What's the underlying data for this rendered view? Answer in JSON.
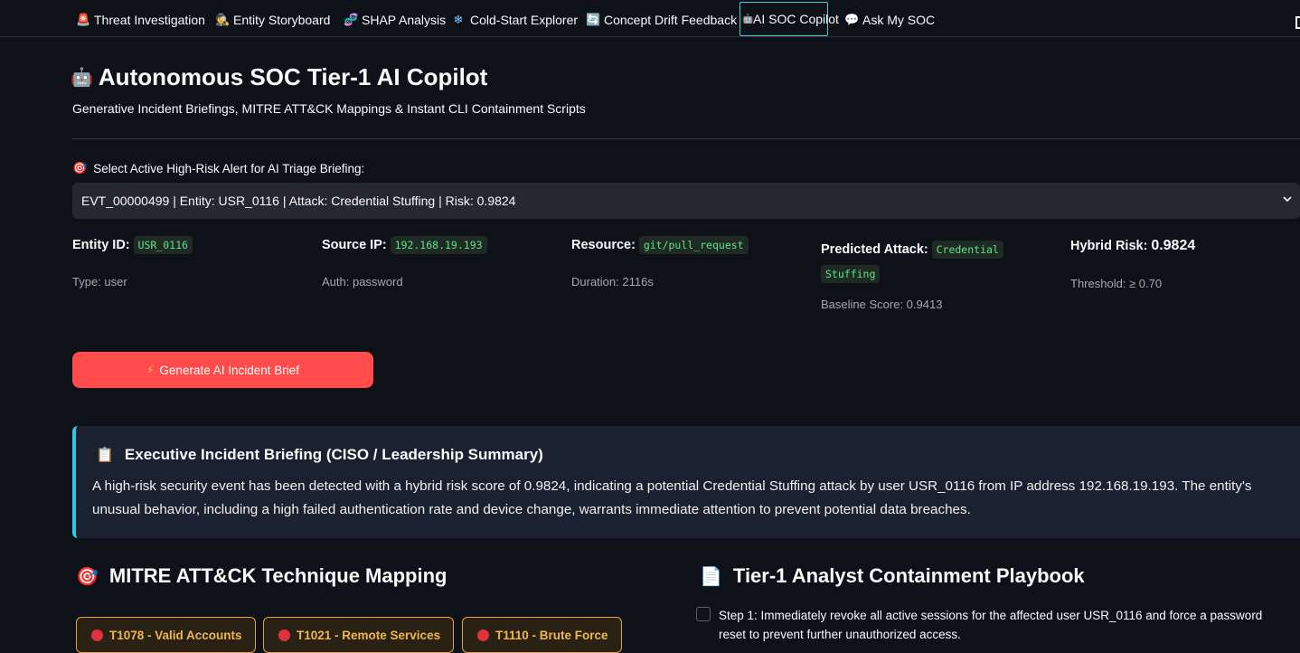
{
  "tabs": [
    {
      "label": "Threat Investigation",
      "icon": "🚨"
    },
    {
      "label": "Entity Storyboard",
      "icon": "🕵"
    },
    {
      "label": "SHAP Analysis",
      "icon": "🧬"
    },
    {
      "label": "Cold-Start Explorer",
      "icon": "❄"
    },
    {
      "label": "Concept Drift Feedback",
      "icon": "🔄"
    },
    {
      "label": "AI SOC Copilot",
      "icon": "🤖"
    },
    {
      "label": "Ask My SOC",
      "icon": "💬"
    }
  ],
  "active_tab": "AI SOC Copilot",
  "page": {
    "title_icon": "🤖",
    "title": "Autonomous SOC Tier-1 AI Copilot",
    "subtitle": "Generative Incident Briefings, MITRE ATT&CK Mappings & Instant CLI Containment Scripts"
  },
  "alert_select": {
    "icon": "🎯",
    "label": "Select Active High-Risk Alert for AI Triage Briefing:",
    "selected": "EVT_00000499 | Entity: USR_0116 | Attack: Credential Stuffing | Risk: 0.9824"
  },
  "metrics": {
    "entity": {
      "label": "Entity ID:",
      "value": "USR_0116",
      "meta": "Type: user"
    },
    "source_ip": {
      "label": "Source IP:",
      "value": "192.168.19.193",
      "meta": "Auth: password"
    },
    "resource": {
      "label": "Resource:",
      "value": "git/pull_request",
      "meta": "Duration: 2116s"
    },
    "predicted": {
      "label": "Predicted Attack:",
      "value_line1": "Credential",
      "value_line2": "Stuffing",
      "meta": "Baseline Score: 0.9413"
    },
    "hybrid": {
      "label": "Hybrid Risk:",
      "value": "0.9824",
      "meta": "Threshold: ≥ 0.70"
    }
  },
  "generate_button": {
    "icon": "⚡",
    "label": "Generate AI Incident Brief"
  },
  "briefing": {
    "icon": "📋",
    "title": "Executive Incident Briefing (CISO / Leadership Summary)",
    "text": "A high-risk security event has been detected with a hybrid risk score of 0.9824, indicating a potential Credential Stuffing attack by user USR_0116 from IP address 192.168.19.193. The entity's unusual behavior, including a high failed authentication rate and device change, warrants immediate attention to prevent potential data breaches."
  },
  "mitre": {
    "icon": "🎯",
    "title": "MITRE ATT&CK Technique Mapping",
    "techniques": [
      "T1078 - Valid Accounts",
      "T1021 - Remote Services",
      "T1110 - Brute Force"
    ]
  },
  "playbook": {
    "icon": "📄",
    "title": "Tier-1 Analyst Containment Playbook",
    "steps": [
      "Step 1: Immediately revoke all active sessions for the affected user USR_0116 and force a password reset to prevent further unauthorized access."
    ]
  },
  "colors": {
    "accent": "#ff4b4b",
    "info_border": "#2ec9e8",
    "code_text": "#5ce488",
    "tag_border": "#e6a23c"
  }
}
